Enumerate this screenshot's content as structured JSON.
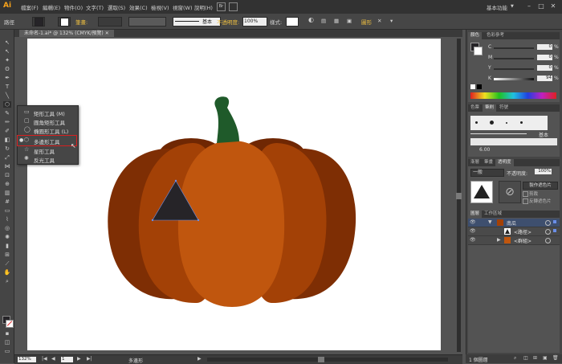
{
  "app": {
    "logo": "Ai"
  },
  "menu": [
    "檔案(F)",
    "編輯(E)",
    "物件(O)",
    "文字(T)",
    "選取(S)",
    "效果(C)",
    "檢視(V)",
    "視窗(W)",
    "說明(H)"
  ],
  "workspace_label": "基本功能",
  "control_bar": {
    "selection_label": "路徑",
    "stroke_label": "筆畫:",
    "stroke_style": "基本",
    "opacity_label": "不透明度:",
    "opacity_value": "100%",
    "style_label": "樣式:",
    "recolor_label": "圖形"
  },
  "document_tab": "未命名-1.ai* @ 132% (CMYK/預覽)",
  "tool_flyout": {
    "items": [
      {
        "label": "矩形工具",
        "shortcut": "(M)",
        "icon": "rectangle-icon"
      },
      {
        "label": "圓角矩形工具",
        "shortcut": "",
        "icon": "rounded-rectangle-icon"
      },
      {
        "label": "橢圓形工具",
        "shortcut": "(L)",
        "icon": "ellipse-icon"
      },
      {
        "label": "多邊形工具",
        "shortcut": "",
        "icon": "polygon-icon",
        "selected": true
      },
      {
        "label": "星形工具",
        "shortcut": "",
        "icon": "star-icon"
      },
      {
        "label": "反光工具",
        "shortcut": "",
        "icon": "flare-icon"
      }
    ]
  },
  "status_bar": {
    "zoom": "132%",
    "page": "1",
    "tool_name": "多邊形"
  },
  "color_panel": {
    "tabs": [
      "顏色",
      "色彩參考"
    ],
    "channels": [
      {
        "label": "C",
        "value": "0",
        "pct": "%"
      },
      {
        "label": "M",
        "value": "0",
        "pct": "%"
      },
      {
        "label": "Y",
        "value": "0",
        "pct": "%"
      },
      {
        "label": "K",
        "value": "94",
        "pct": "%"
      }
    ]
  },
  "stroke_panel": {
    "tabs": [
      "色票",
      "筆刷",
      "符號"
    ],
    "brush_label": "基本",
    "brush_size": "6.00"
  },
  "transparency_panel": {
    "tabs": [
      "漸層",
      "筆畫",
      "透明度"
    ],
    "blend_mode": "一般",
    "opacity_label": "不透明度:",
    "opacity_value": "100%",
    "make_mask_label": "製作遮色片",
    "clip_label": "剪裁",
    "invert_label": "反轉遮色片"
  },
  "layers_panel": {
    "tabs": [
      "圖層",
      "工作區域"
    ],
    "layers": [
      {
        "name": "南瓜",
        "level": 0
      },
      {
        "name": "<路徑>",
        "level": 1
      },
      {
        "name": "<群組>",
        "level": 1
      }
    ],
    "footer": "1 個圖層"
  },
  "colors": {
    "pumpkin_dark": "#7e2e04",
    "pumpkin_mid": "#a34106",
    "pumpkin_light": "#c0560e",
    "stem": "#1f5a2a",
    "triangle": "#262428",
    "highlight_red": "#d62020"
  }
}
